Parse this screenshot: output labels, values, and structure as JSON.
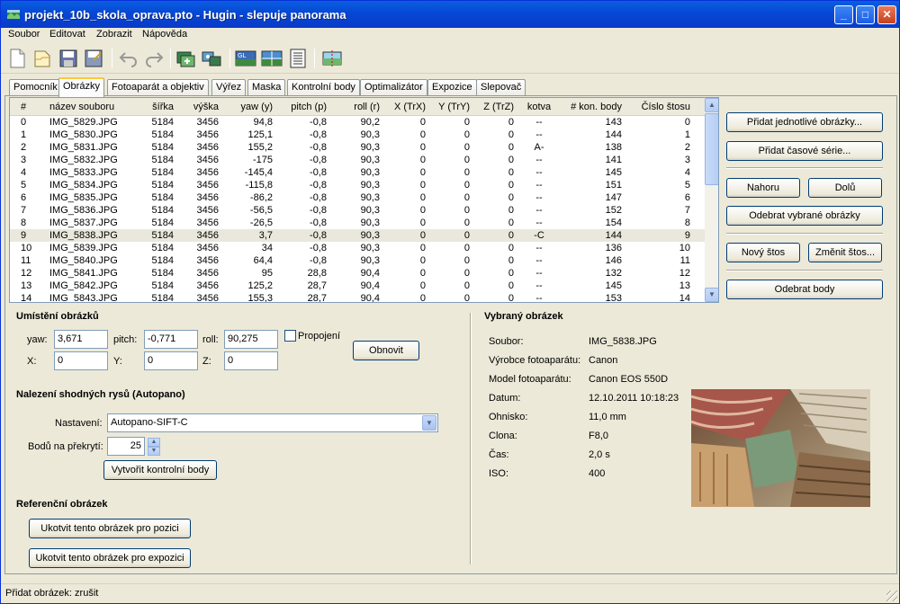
{
  "window": {
    "title": "projekt_10b_skola_oprava.pto - Hugin - slepuje panorama"
  },
  "menu": [
    "Soubor",
    "Editovat",
    "Zobrazit",
    "Nápověda"
  ],
  "tabs": [
    "Pomocník",
    "Obrázky",
    "Fotoaparát a objektiv",
    "Výřez",
    "Maska",
    "Kontrolní body",
    "Optimalizátor",
    "Expozice",
    "Slepovač"
  ],
  "active_tab": "Obrázky",
  "list": {
    "columns": [
      "#",
      "název souboru",
      "šířka",
      "výška",
      "yaw (y)",
      "pitch (p)",
      "roll (r)",
      "X (TrX)",
      "Y (TrY)",
      "Z (TrZ)",
      "kotva",
      "# kon. body",
      "Číslo štosu"
    ],
    "rows": [
      [
        "0",
        "IMG_5829.JPG",
        "5184",
        "3456",
        "94,8",
        "-0,8",
        "90,2",
        "0",
        "0",
        "0",
        "--",
        "143",
        "0"
      ],
      [
        "1",
        "IMG_5830.JPG",
        "5184",
        "3456",
        "125,1",
        "-0,8",
        "90,3",
        "0",
        "0",
        "0",
        "--",
        "144",
        "1"
      ],
      [
        "2",
        "IMG_5831.JPG",
        "5184",
        "3456",
        "155,2",
        "-0,8",
        "90,3",
        "0",
        "0",
        "0",
        "A-",
        "138",
        "2"
      ],
      [
        "3",
        "IMG_5832.JPG",
        "5184",
        "3456",
        "-175",
        "-0,8",
        "90,3",
        "0",
        "0",
        "0",
        "--",
        "141",
        "3"
      ],
      [
        "4",
        "IMG_5833.JPG",
        "5184",
        "3456",
        "-145,4",
        "-0,8",
        "90,3",
        "0",
        "0",
        "0",
        "--",
        "145",
        "4"
      ],
      [
        "5",
        "IMG_5834.JPG",
        "5184",
        "3456",
        "-115,8",
        "-0,8",
        "90,3",
        "0",
        "0",
        "0",
        "--",
        "151",
        "5"
      ],
      [
        "6",
        "IMG_5835.JPG",
        "5184",
        "3456",
        "-86,2",
        "-0,8",
        "90,3",
        "0",
        "0",
        "0",
        "--",
        "147",
        "6"
      ],
      [
        "7",
        "IMG_5836.JPG",
        "5184",
        "3456",
        "-56,5",
        "-0,8",
        "90,3",
        "0",
        "0",
        "0",
        "--",
        "152",
        "7"
      ],
      [
        "8",
        "IMG_5837.JPG",
        "5184",
        "3456",
        "-26,5",
        "-0,8",
        "90,3",
        "0",
        "0",
        "0",
        "--",
        "154",
        "8"
      ],
      [
        "9",
        "IMG_5838.JPG",
        "5184",
        "3456",
        "3,7",
        "-0,8",
        "90,3",
        "0",
        "0",
        "0",
        "-C",
        "144",
        "9"
      ],
      [
        "10",
        "IMG_5839.JPG",
        "5184",
        "3456",
        "34",
        "-0,8",
        "90,3",
        "0",
        "0",
        "0",
        "--",
        "136",
        "10"
      ],
      [
        "11",
        "IMG_5840.JPG",
        "5184",
        "3456",
        "64,4",
        "-0,8",
        "90,3",
        "0",
        "0",
        "0",
        "--",
        "146",
        "11"
      ],
      [
        "12",
        "IMG_5841.JPG",
        "5184",
        "3456",
        "95",
        "28,8",
        "90,4",
        "0",
        "0",
        "0",
        "--",
        "132",
        "12"
      ],
      [
        "13",
        "IMG_5842.JPG",
        "5184",
        "3456",
        "125,2",
        "28,7",
        "90,4",
        "0",
        "0",
        "0",
        "--",
        "145",
        "13"
      ],
      [
        "14",
        "IMG_5843.JPG",
        "5184",
        "3456",
        "155,3",
        "28,7",
        "90,4",
        "0",
        "0",
        "0",
        "--",
        "153",
        "14"
      ]
    ],
    "selected_row": 9
  },
  "side_buttons": {
    "add_single": "Přidat jednotlivé obrázky...",
    "add_series": "Přidat časové série...",
    "up": "Nahoru",
    "down": "Dolů",
    "remove_selected": "Odebrat vybrané obrázky",
    "new_stack": "Nový štos",
    "change_stack": "Změnit štos...",
    "remove_points": "Odebrat body"
  },
  "position": {
    "heading": "Umístění obrázků",
    "yaw_label": "yaw:",
    "yaw": "3,671",
    "pitch_label": "pitch:",
    "pitch": "-0,771",
    "roll_label": "roll:",
    "roll": "90,275",
    "link_label": "Propojení",
    "x_label": "X:",
    "x": "0",
    "y_label": "Y:",
    "y": "0",
    "z_label": "Z:",
    "z": "0",
    "refresh": "Obnovit"
  },
  "features": {
    "heading": "Nalezení shodných rysů (Autopano)",
    "settings_label": "Nastavení:",
    "settings_value": "Autopano-SIFT-C",
    "points_label": "Bodů na překrytí:",
    "points_value": "25",
    "create": "Vytvořit kontrolní body"
  },
  "reference": {
    "heading": "Referenční obrázek",
    "anchor_position": "Ukotvit tento obrázek pro pozici",
    "anchor_exposure": "Ukotvit tento obrázek pro expozici"
  },
  "selected": {
    "heading": "Vybraný obrázek",
    "fields": [
      {
        "label": "Soubor:",
        "value": "IMG_5838.JPG"
      },
      {
        "label": "Výrobce fotoaparátu:",
        "value": "Canon"
      },
      {
        "label": "Model fotoaparátu:",
        "value": "Canon EOS 550D"
      },
      {
        "label": "Datum:",
        "value": "12.10.2011 10:18:23"
      },
      {
        "label": "Ohnisko:",
        "value": "11,0 mm"
      },
      {
        "label": "Clona:",
        "value": "F8,0"
      },
      {
        "label": "Čas:",
        "value": "2,0 s"
      },
      {
        "label": "ISO:",
        "value": "400"
      }
    ]
  },
  "status": "Přidat obrázek: zrušit",
  "toolbar_icons": [
    "new-project-icon",
    "open-project-icon",
    "save-icon",
    "save-as-icon",
    "undo-icon",
    "redo-icon",
    "add-images-icon",
    "assistant-icon",
    "opengl-preview-icon",
    "fast-preview-icon",
    "batch-list-icon",
    "stitch-icon"
  ]
}
